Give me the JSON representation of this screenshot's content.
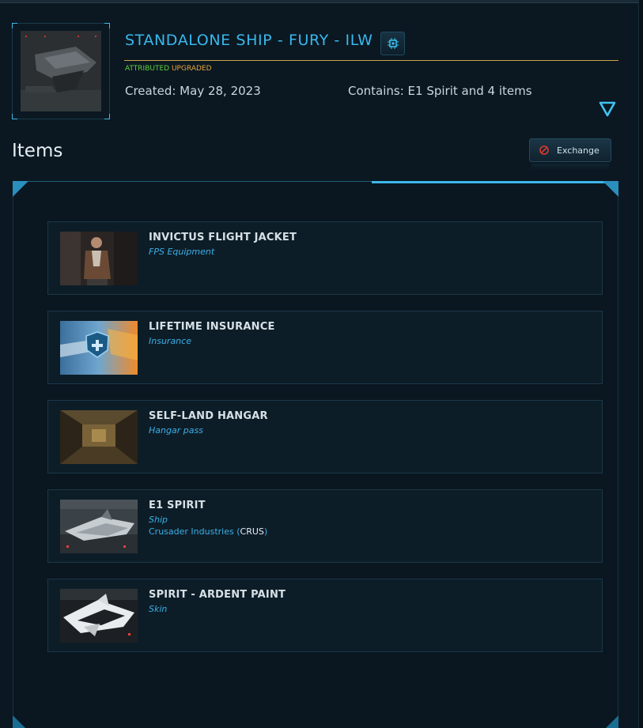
{
  "header": {
    "title": "STANDALONE SHIP - FURY - ILW",
    "tag_attributed": "ATTRIBUTED",
    "tag_upgraded": "UPGRADED",
    "created": "Created: May 28, 2023",
    "contains": "Contains: E1 Spirit and 4 items",
    "chip_icon": "chip-icon",
    "expand_icon": "triangle-down-icon"
  },
  "items_section": {
    "heading": "Items",
    "exchange_label": "Exchange",
    "exchange_icon": "no-entry-icon"
  },
  "items": [
    {
      "name": "INVICTUS FLIGHT JACKET",
      "type": "FPS Equipment",
      "manufacturer": "",
      "manufacturer_code": ""
    },
    {
      "name": "LIFETIME INSURANCE",
      "type": "Insurance",
      "manufacturer": "",
      "manufacturer_code": ""
    },
    {
      "name": "SELF-LAND HANGAR",
      "type": "Hangar pass",
      "manufacturer": "",
      "manufacturer_code": ""
    },
    {
      "name": "E1 SPIRIT",
      "type": "Ship",
      "manufacturer": "Crusader Industries",
      "manufacturer_code": "CRUS"
    },
    {
      "name": "SPIRIT - ARDENT PAINT",
      "type": "Skin",
      "manufacturer": "",
      "manufacturer_code": ""
    }
  ],
  "colors": {
    "accent": "#38b8ec",
    "attributed": "#5fd13c",
    "upgraded": "#e7a43a",
    "divider": "#c9a24a"
  }
}
